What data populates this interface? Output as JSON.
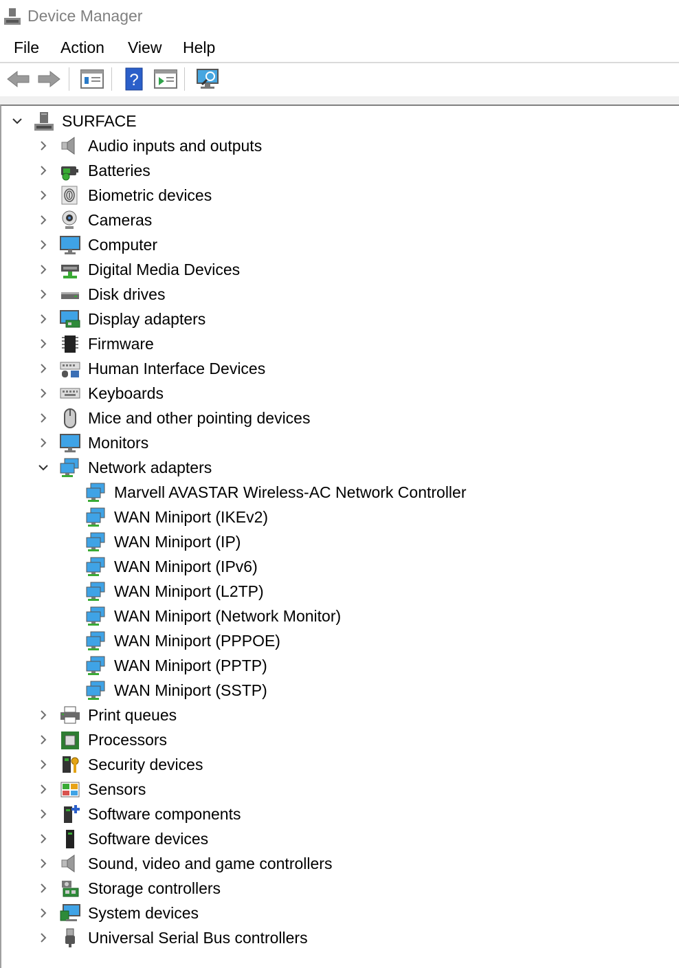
{
  "window": {
    "title": "Device Manager"
  },
  "menu": {
    "file": "File",
    "action": "Action",
    "view": "View",
    "help": "Help"
  },
  "toolbar": {
    "buttons": [
      "back-arrow-icon",
      "forward-arrow-icon",
      "properties-icon",
      "help-icon",
      "update-driver-icon",
      "scan-hardware-icon"
    ]
  },
  "tree": {
    "root": {
      "label": "SURFACE",
      "icon": "computer-tower-icon",
      "expanded": true
    },
    "categories": [
      {
        "label": "Audio inputs and outputs",
        "icon": "speaker-icon"
      },
      {
        "label": "Batteries",
        "icon": "battery-icon"
      },
      {
        "label": "Biometric devices",
        "icon": "fingerprint-icon"
      },
      {
        "label": "Cameras",
        "icon": "webcam-icon"
      },
      {
        "label": "Computer",
        "icon": "monitor-icon"
      },
      {
        "label": "Digital Media Devices",
        "icon": "media-device-icon"
      },
      {
        "label": "Disk drives",
        "icon": "disk-drive-icon"
      },
      {
        "label": "Display adapters",
        "icon": "display-adapter-icon"
      },
      {
        "label": "Firmware",
        "icon": "chip-icon"
      },
      {
        "label": "Human Interface Devices",
        "icon": "hid-icon"
      },
      {
        "label": "Keyboards",
        "icon": "keyboard-icon"
      },
      {
        "label": "Mice and other pointing devices",
        "icon": "mouse-icon"
      },
      {
        "label": "Monitors",
        "icon": "monitor-icon"
      },
      {
        "label": "Network adapters",
        "icon": "network-icon",
        "expanded": true,
        "children": [
          "Marvell AVASTAR Wireless-AC Network Controller",
          "WAN Miniport (IKEv2)",
          "WAN Miniport (IP)",
          "WAN Miniport (IPv6)",
          "WAN Miniport (L2TP)",
          "WAN Miniport (Network Monitor)",
          "WAN Miniport (PPPOE)",
          "WAN Miniport (PPTP)",
          "WAN Miniport (SSTP)"
        ]
      },
      {
        "label": "Print queues",
        "icon": "printer-icon"
      },
      {
        "label": "Processors",
        "icon": "processor-icon"
      },
      {
        "label": "Security devices",
        "icon": "security-key-icon"
      },
      {
        "label": "Sensors",
        "icon": "sensor-icon"
      },
      {
        "label": "Software components",
        "icon": "software-component-icon"
      },
      {
        "label": "Software devices",
        "icon": "software-device-icon"
      },
      {
        "label": "Sound, video and game controllers",
        "icon": "speaker-icon"
      },
      {
        "label": "Storage controllers",
        "icon": "storage-controller-icon"
      },
      {
        "label": "System devices",
        "icon": "system-device-icon"
      },
      {
        "label": "Universal Serial Bus controllers",
        "icon": "usb-icon"
      }
    ]
  }
}
